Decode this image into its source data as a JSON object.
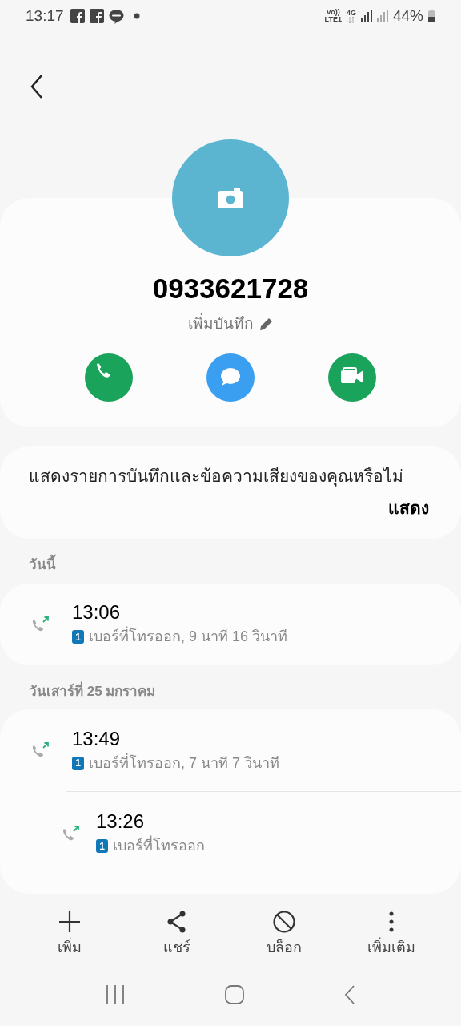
{
  "status_bar": {
    "time": "13:17",
    "network": "Vo))",
    "network_sub": "LTE1",
    "data_type": "4G",
    "battery": "44%"
  },
  "contact": {
    "number": "0933621728",
    "note_link": "เพิ่มบันทึก"
  },
  "actions": [
    {
      "kind": "call"
    },
    {
      "kind": "message"
    },
    {
      "kind": "video"
    }
  ],
  "prompt": {
    "text": "แสดงรายการบันทึกและข้อความเสียงของคุณหรือไม่",
    "button": "แสดง"
  },
  "call_groups": [
    {
      "date": "วันนี้",
      "calls": [
        {
          "time": "13:06",
          "sim": "1",
          "detail": "เบอร์ที่โทรออก, 9 นาที 16 วินาที"
        }
      ]
    },
    {
      "date": "วันเสาร์ที่ 25 มกราคม",
      "calls": [
        {
          "time": "13:49",
          "sim": "1",
          "detail": "เบอร์ที่โทรออก, 7 นาที 7 วินาที"
        },
        {
          "time": "13:26",
          "sim": "1",
          "detail": "เบอร์ที่โทรออก"
        }
      ]
    }
  ],
  "toolbar": [
    {
      "kind": "add",
      "label": "เพิ่ม"
    },
    {
      "kind": "share",
      "label": "แชร์"
    },
    {
      "kind": "block",
      "label": "บล็อก"
    },
    {
      "kind": "more",
      "label": "เพิ่มเติม"
    }
  ]
}
